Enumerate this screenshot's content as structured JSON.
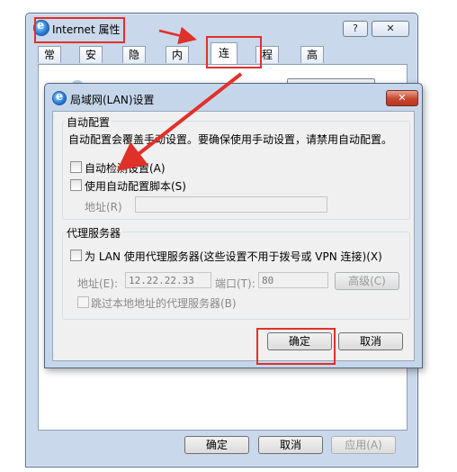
{
  "internet_options": {
    "title": "Internet 属性",
    "help_label": "?",
    "close_label": "✕",
    "tabs": [
      "常规",
      "安全",
      "隐私",
      "内容",
      "连接",
      "程序",
      "高级"
    ],
    "active_tab": "连接",
    "buttons": {
      "ok": "确定",
      "cancel": "取消",
      "apply": "应用(A)"
    }
  },
  "lan_dialog": {
    "title": "局域网(LAN)设置",
    "close_label": "✕",
    "auto_config": {
      "group_title": "自动配置",
      "description": "自动配置会覆盖手动设置。要确保使用手动设置，请禁用自动配置。",
      "auto_detect_label": "自动检测设置(A)",
      "auto_detect_checked": false,
      "use_script_label": "使用自动配置脚本(S)",
      "use_script_checked": false,
      "address_label": "地址(R)",
      "address_value": ""
    },
    "proxy": {
      "group_title": "代理服务器",
      "use_proxy_label": "为 LAN 使用代理服务器(这些设置不用于拨号或 VPN 连接)(X)",
      "use_proxy_checked": false,
      "address_label": "地址(E):",
      "address_value": "12.22.22.33",
      "port_label": "端口(T):",
      "port_value": "80",
      "advanced_label": "高级(C)",
      "bypass_local_label": "跳过本地地址的代理服务器(B)",
      "bypass_local_checked": false
    },
    "buttons": {
      "ok": "确定",
      "cancel": "取消"
    }
  },
  "colors": {
    "annotation_red": "#e0302a",
    "window_frame": "#c9d8ea"
  }
}
